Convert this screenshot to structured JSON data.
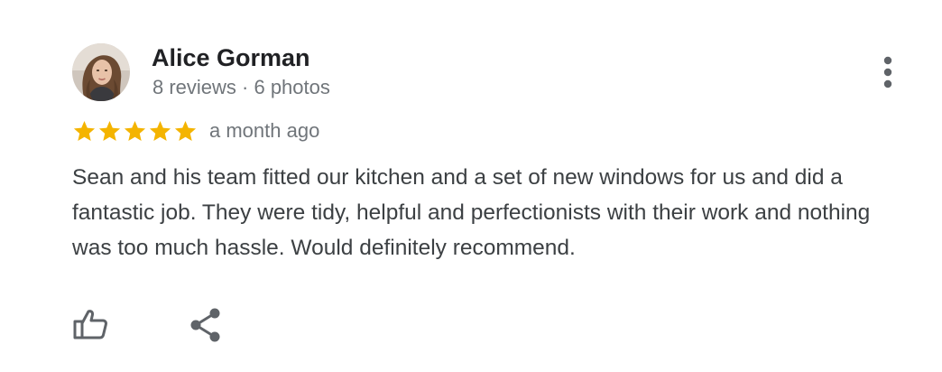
{
  "review": {
    "author": {
      "name": "Alice Gorman",
      "meta": "8 reviews · 6 photos",
      "avatar_icon": "user-avatar-photo"
    },
    "rating": {
      "stars": 5,
      "max": 5,
      "color": "#f4b400"
    },
    "time_ago": "a month ago",
    "text": "Sean and his team fitted our kitchen and a set of new windows for us and did a fantastic job. They were tidy, helpful and perfectionists with their work and nothing was too much hassle. Would definitely recommend.",
    "actions": {
      "like_icon": "thumbs-up-icon",
      "share_icon": "share-icon",
      "more_icon": "more-vert-icon"
    }
  },
  "colors": {
    "name": "#202124",
    "meta": "#70757a",
    "body_text": "#3c4043",
    "icon": "#5f6368"
  }
}
